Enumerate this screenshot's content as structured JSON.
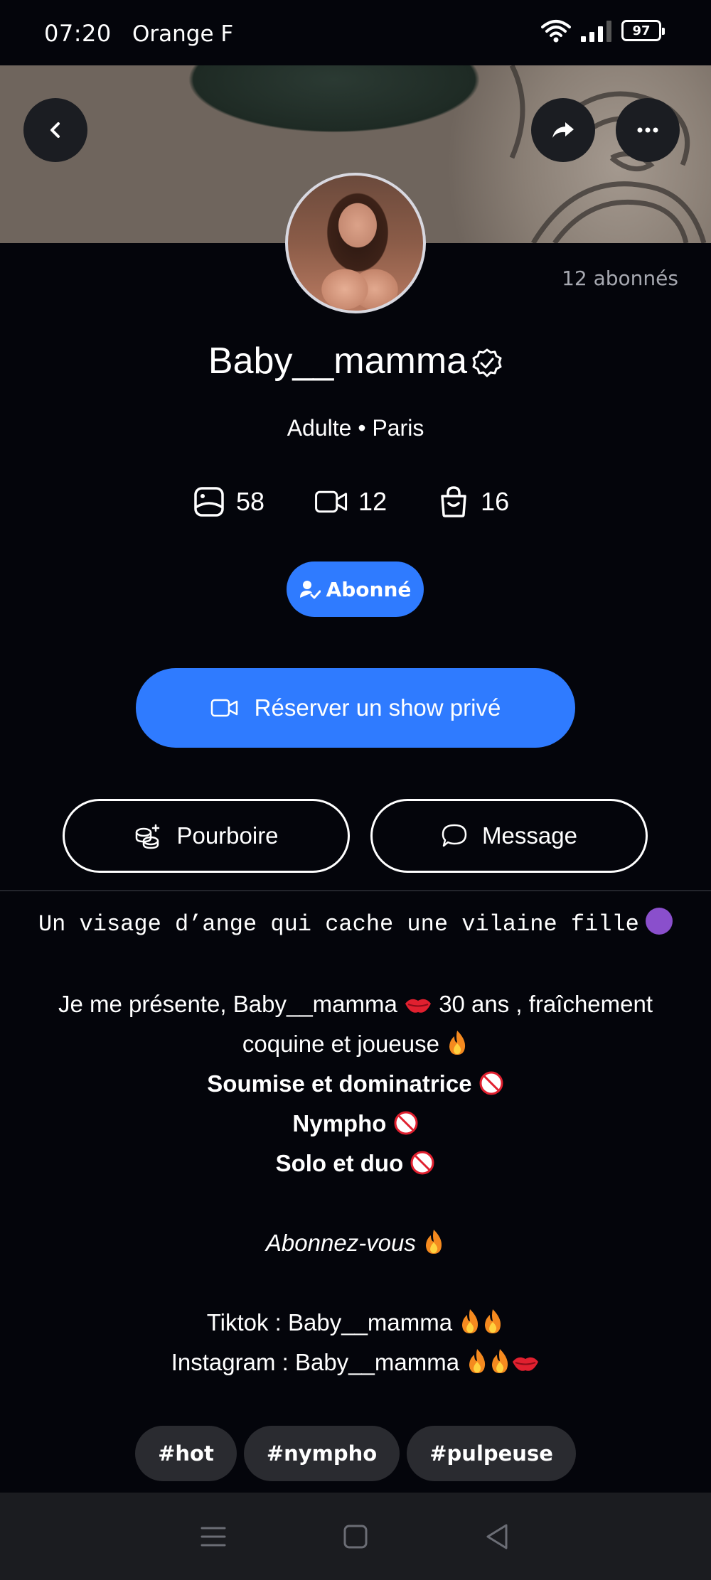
{
  "status_bar": {
    "time": "07:20",
    "carrier": "Orange F",
    "battery": "97"
  },
  "profile": {
    "subscribers": "12 abonnés",
    "name": "Baby__mamma",
    "location": "Adulte • Paris",
    "stats": {
      "photos": "58",
      "videos": "12",
      "products": "16"
    }
  },
  "actions": {
    "subscribed_label": "Abonné",
    "private_show_label": "Réserver un show privé",
    "tip_label": "Pourboire",
    "message_label": "Message"
  },
  "bio": {
    "line1": "Un visage d’ange qui cache une vilaine fille",
    "line2a": "Je me présente, Baby__mamma",
    "line2b": "30 ans , fraîchement",
    "line3": "coquine et joueuse",
    "line4": "Soumise et dominatrice",
    "line5": "Nympho",
    "line6": "Solo et duo",
    "line7": "Abonnez-vous",
    "line8": "Tiktok : Baby__mamma",
    "line9": "Instagram : Baby__mamma"
  },
  "tags": [
    "#hot",
    "#nympho",
    "#pulpeuse"
  ],
  "colors": {
    "background": "#04050b",
    "accent": "#2f7bff",
    "tag_bg": "#2a2b30",
    "nav_bg": "#1b1c20"
  }
}
